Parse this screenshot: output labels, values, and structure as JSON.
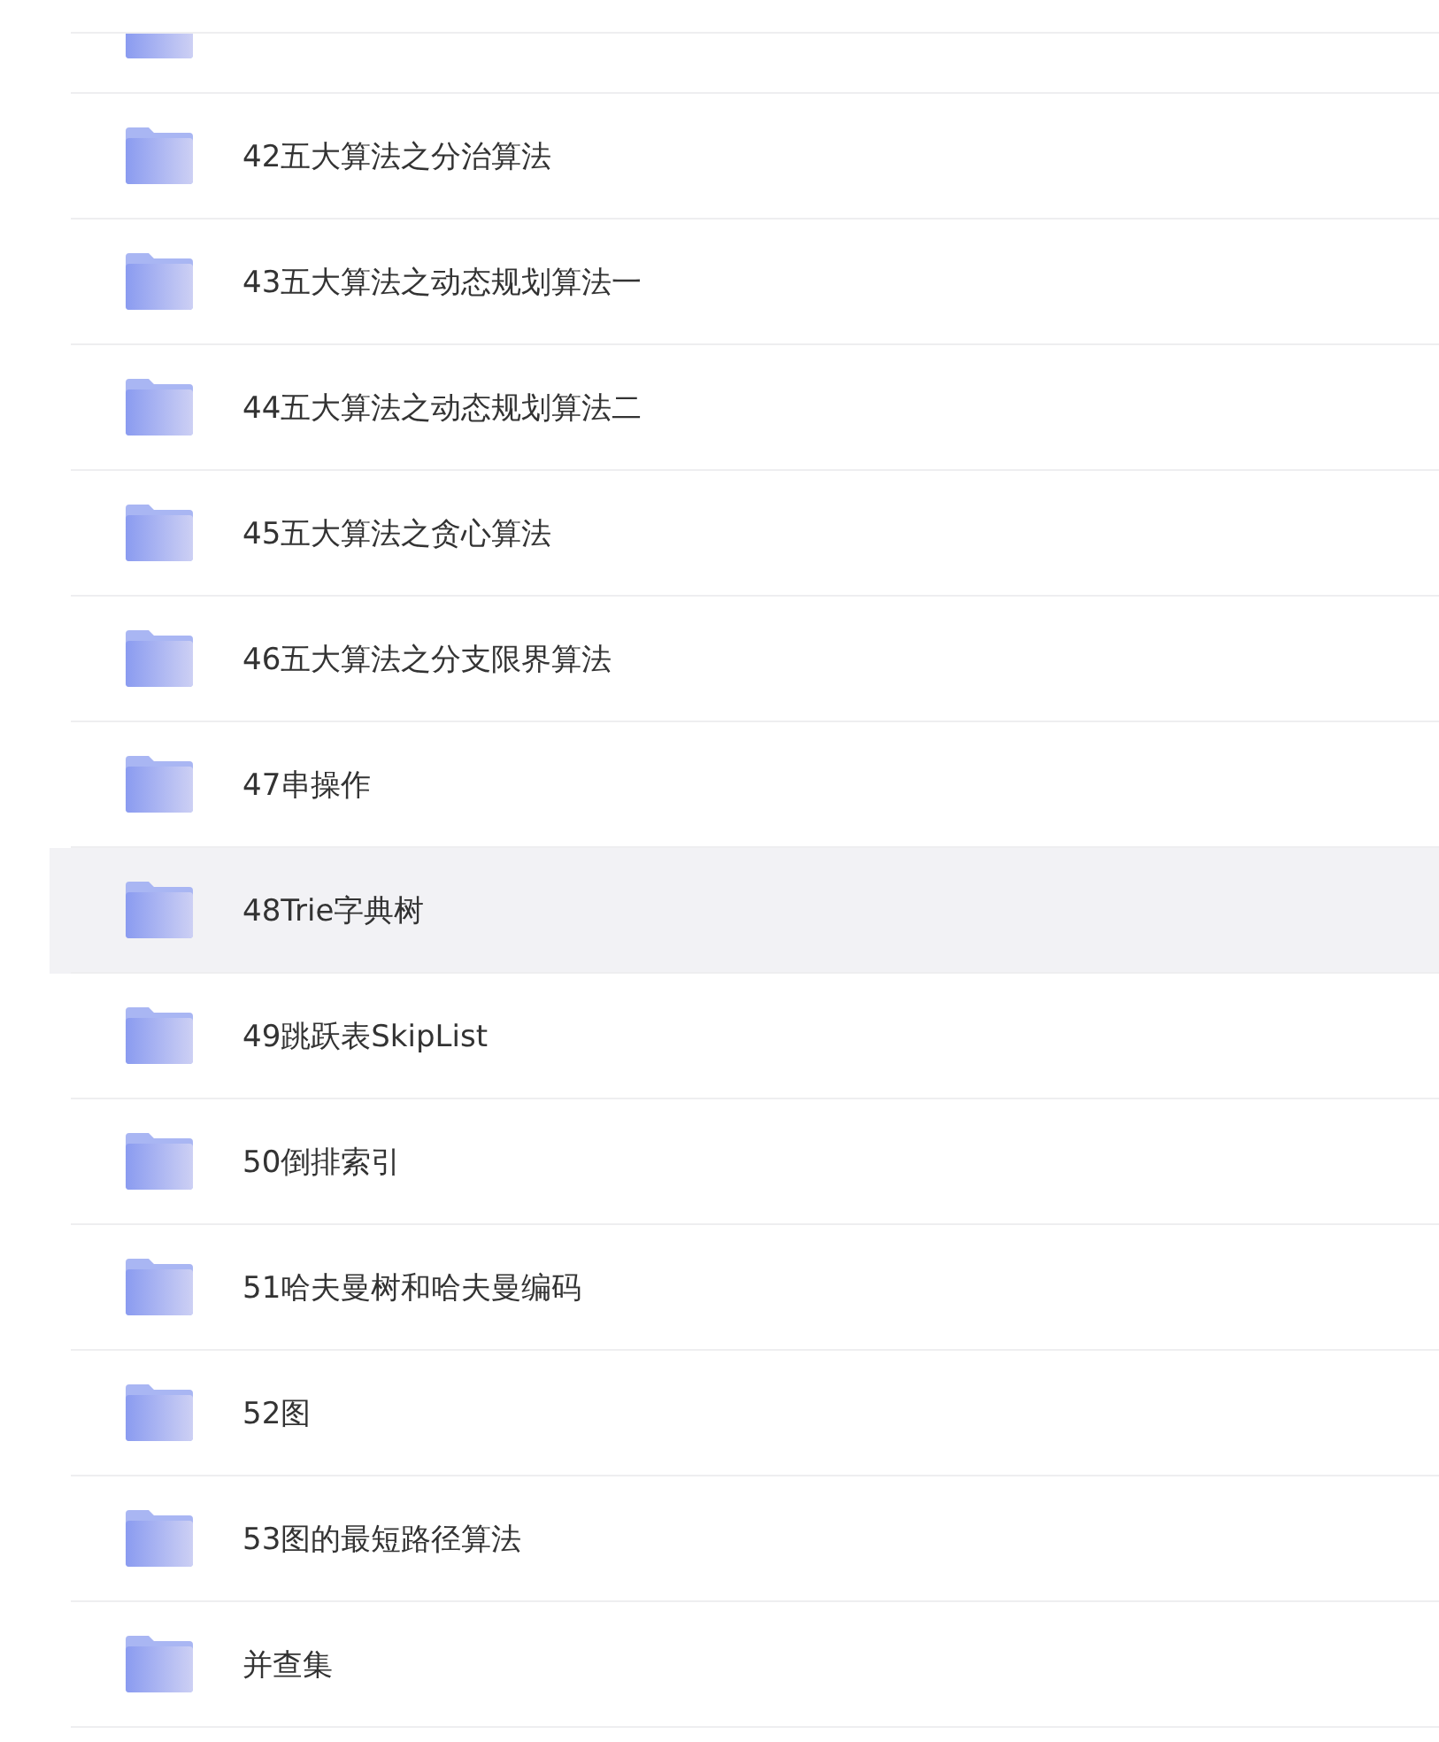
{
  "file_list": {
    "partial_top_row": {
      "kind": "folder"
    },
    "rows": [
      {
        "name": "42五大算法之分治算法",
        "highlighted": false
      },
      {
        "name": "43五大算法之动态规划算法一",
        "highlighted": false
      },
      {
        "name": "44五大算法之动态规划算法二",
        "highlighted": false
      },
      {
        "name": "45五大算法之贪心算法",
        "highlighted": false
      },
      {
        "name": "46五大算法之分支限界算法",
        "highlighted": false
      },
      {
        "name": "47串操作",
        "highlighted": false
      },
      {
        "name": "48Trie字典树",
        "highlighted": true
      },
      {
        "name": "49跳跃表SkipList",
        "highlighted": false
      },
      {
        "name": "50倒排索引",
        "highlighted": false
      },
      {
        "name": "51哈夫曼树和哈夫曼编码",
        "highlighted": false
      },
      {
        "name": "52图",
        "highlighted": false
      },
      {
        "name": "53图的最短路径算法",
        "highlighted": false
      },
      {
        "name": "并查集",
        "highlighted": false
      }
    ]
  }
}
